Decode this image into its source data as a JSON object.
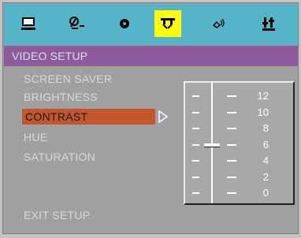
{
  "colors": {
    "icon_bar": "#54b5c8",
    "title_bar": "#8f5a9c",
    "panel": "#9fa0a0",
    "selected_item": "#c4562e",
    "active_tab": "#ffff00"
  },
  "tabs": [
    {
      "name": "monitor-icon",
      "active": false
    },
    {
      "name": "language-icon",
      "active": false
    },
    {
      "name": "disc-icon",
      "active": false
    },
    {
      "name": "video-icon",
      "active": true
    },
    {
      "name": "audio-speaker-icon",
      "active": false
    },
    {
      "name": "equalizer-icon",
      "active": false
    }
  ],
  "title": "VIDEO SETUP",
  "menu_items": [
    "SCREEN SAVER",
    "BRIGHTNESS",
    "CONTRAST",
    "HUE",
    "SATURATION"
  ],
  "selected_index": 2,
  "slider": {
    "labels": [
      "12",
      "10",
      "8",
      "6",
      "4",
      "2",
      "0"
    ],
    "value": 6,
    "min": 0,
    "max": 12
  },
  "exit_label": "EXIT SETUP"
}
